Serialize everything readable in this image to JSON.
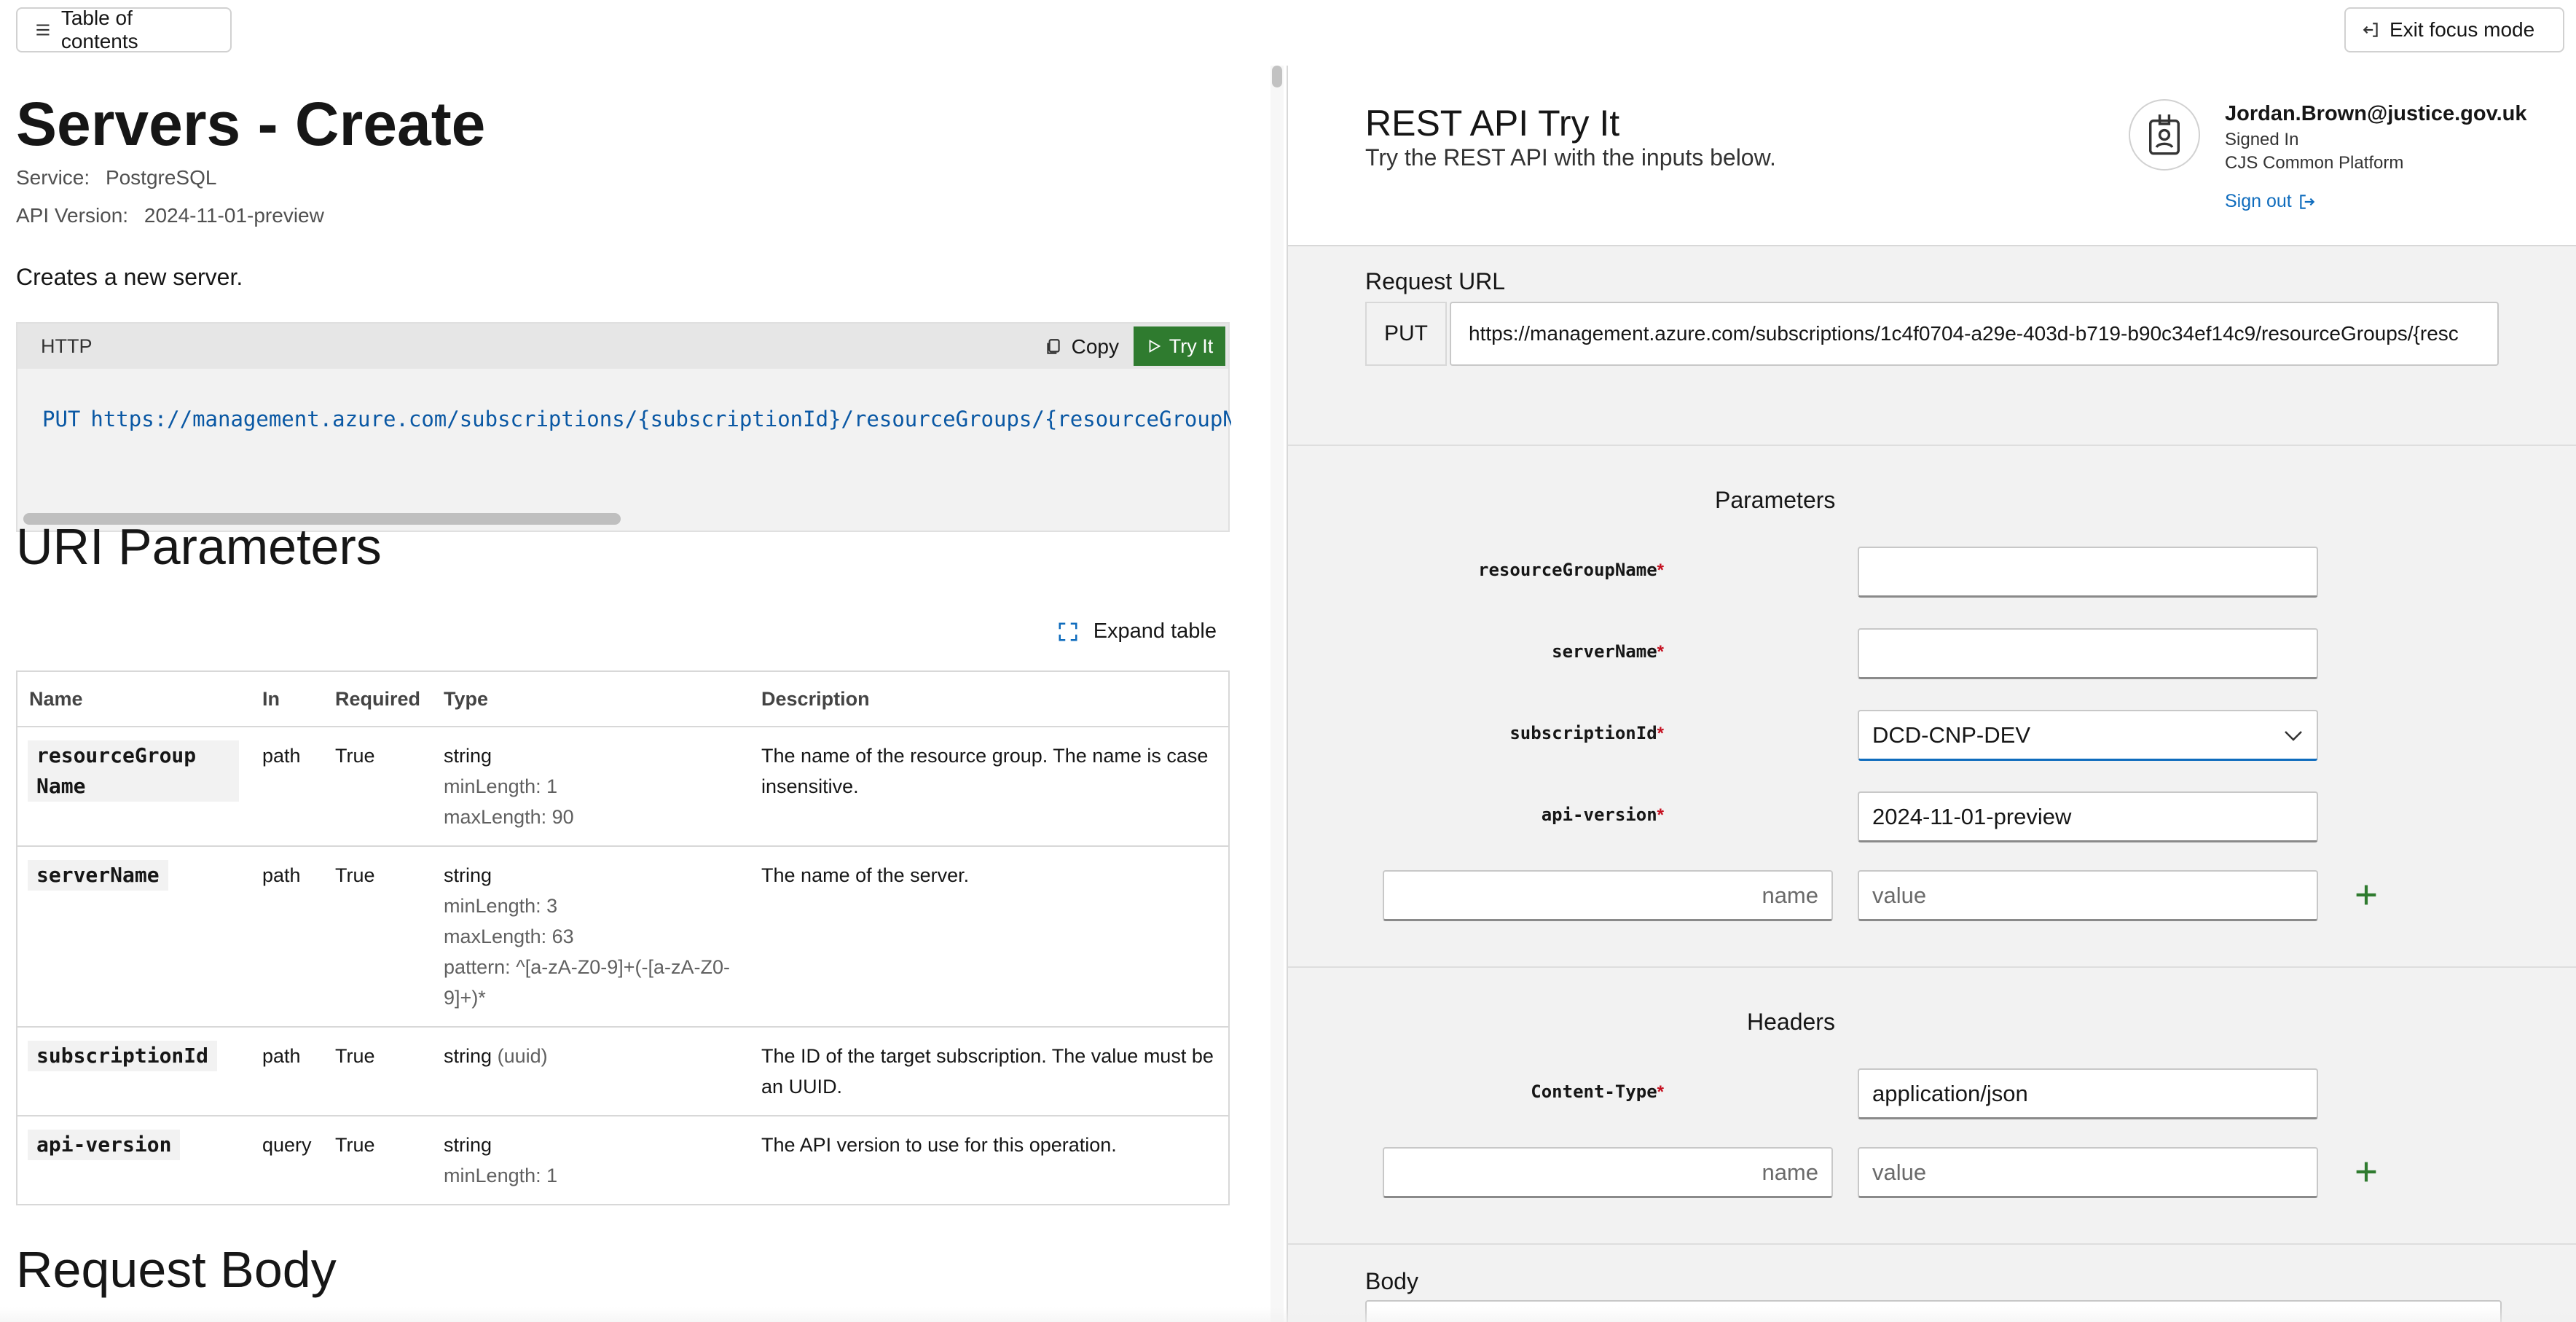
{
  "topbar": {
    "toc_label": "Table of contents",
    "exit_label": "Exit focus mode"
  },
  "article": {
    "title": "Servers - Create",
    "service_label": "Service:",
    "service_value": "PostgreSQL",
    "api_version_label": "API Version:",
    "api_version_value": "2024-11-01-preview",
    "description": "Creates a new server.",
    "code": {
      "lang": "HTTP",
      "copy_label": "Copy",
      "try_label": "Try It",
      "verb": "PUT",
      "url": "https://management.azure.com/subscriptions/{subscriptionId}/resourceGroups/{resourceGroupName"
    },
    "uri_params_heading": "URI Parameters",
    "expand_label": "Expand table",
    "table": {
      "headers": [
        "Name",
        "In",
        "Required",
        "Type",
        "Description"
      ],
      "rows": [
        {
          "name": "resourceGroup Name",
          "in": "path",
          "required": "True",
          "type": "string",
          "constraints": [
            "minLength: 1",
            "maxLength: 90"
          ],
          "description": "The name of the resource group. The name is case insensitive."
        },
        {
          "name": "serverName",
          "in": "path",
          "required": "True",
          "type": "string",
          "constraints": [
            "minLength: 3",
            "maxLength: 63",
            "pattern: ^[a-zA-Z0-9]+(-[a-zA-Z0-9]+)*"
          ],
          "description": "The name of the server."
        },
        {
          "name": "subscriptionId",
          "in": "path",
          "required": "True",
          "type": "string",
          "type_extra": "(uuid)",
          "constraints": [],
          "description": "The ID of the target subscription. The value must be an UUID."
        },
        {
          "name": "api-version",
          "in": "query",
          "required": "True",
          "type": "string",
          "constraints": [
            "minLength: 1"
          ],
          "description": "The API version to use for this operation."
        }
      ]
    },
    "request_body_heading": "Request Body"
  },
  "tryit": {
    "title": "REST API Try It",
    "subtitle": "Try the REST API with the inputs below.",
    "user": {
      "email": "Jordan.Brown@justice.gov.uk",
      "status": "Signed In",
      "org": "CJS Common Platform",
      "signout_label": "Sign out"
    },
    "request_url_label": "Request URL",
    "verb": "PUT",
    "url": "https://management.azure.com/subscriptions/1c4f0704-a29e-403d-b719-b90c34ef14c9/resourceGroups/{resc",
    "parameters_heading": "Parameters",
    "params": [
      {
        "label": "resourceGroupName",
        "value": ""
      },
      {
        "label": "serverName",
        "value": ""
      },
      {
        "label": "subscriptionId",
        "value": "DCD-CNP-DEV"
      },
      {
        "label": "api-version",
        "value": "2024-11-01-preview"
      }
    ],
    "name_placeholder": "name",
    "value_placeholder": "value",
    "headers_heading": "Headers",
    "headers": [
      {
        "label": "Content-Type",
        "value": "application/json"
      }
    ],
    "body_label": "Body",
    "required_mark": "*"
  },
  "colors": {
    "accent_green": "#2f7b2f",
    "link_blue": "#0f6cbd",
    "required_red": "#c50f1f"
  }
}
